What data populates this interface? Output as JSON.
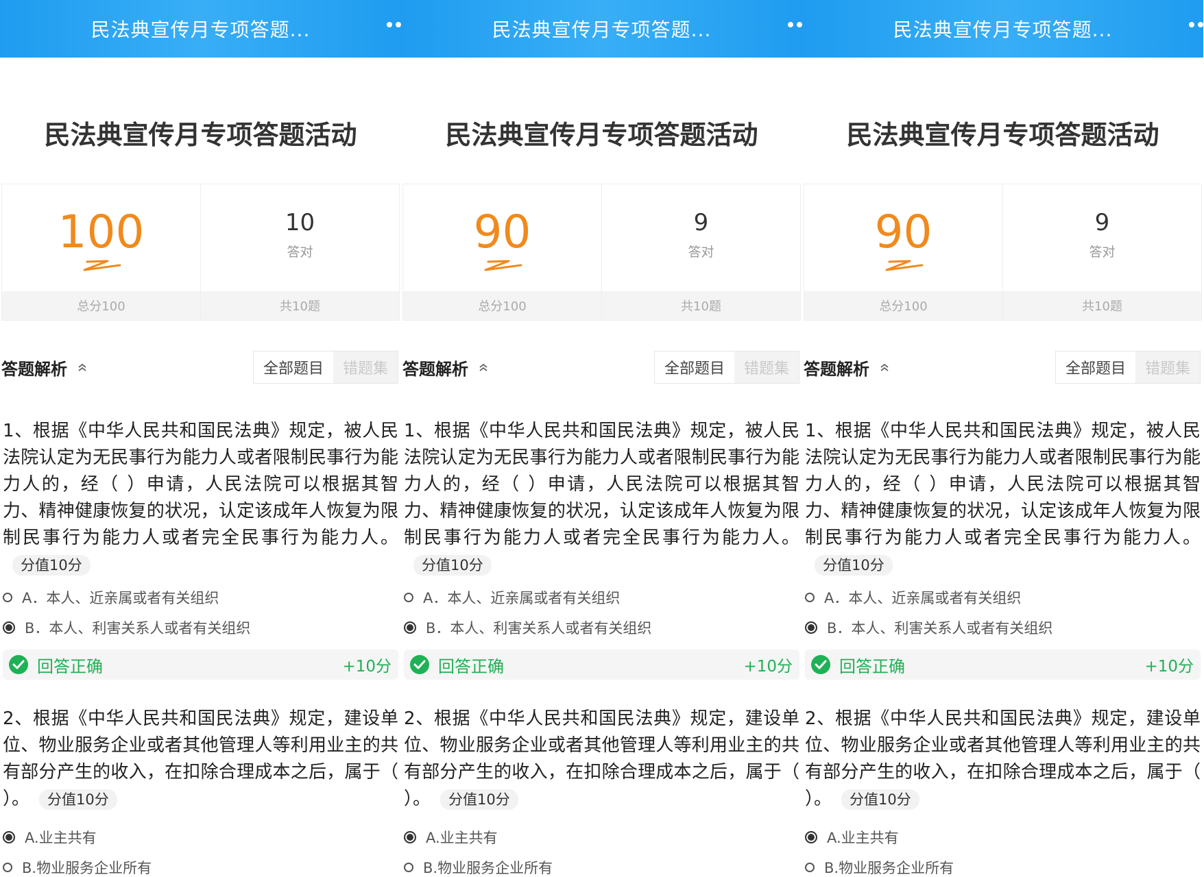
{
  "screens": [
    {
      "topbar_title": "民法典宣传月专项答题...",
      "activity_title": "民法典宣传月专项答题活动",
      "score": "100",
      "total_score_label": "总分100",
      "correct_count": "10",
      "correct_label": "答对",
      "total_questions_label": "共10题",
      "analysis_title": "答题解析",
      "tab_all": "全部题目",
      "tab_wrong": "错题集",
      "q1_text": "1、根据《中华人民共和国民法典》规定，被人民法院认定为无民事行为能力人或者限制民事行为能力人的，经（ ）申请，人民法院可以根据其智力、精神健康恢复的状况，认定该成年人恢复为限制民事行为能力人或者完全民事行为能力人。",
      "q1_points": "分值10分",
      "q1_option_a": "A．本人、近亲属或者有关组织",
      "q1_option_b": "B．本人、利害关系人或者有关组织",
      "q1_result": "回答正确",
      "q1_gain": "+10分",
      "q2_text": "2、根据《中华人民共和国民法典》规定，建设单位、物业服务企业或者其他管理人等利用业主的共有部分产生的收入，在扣除合理成本之后，属于（ ）。",
      "q2_points": "分值10分",
      "q2_option_a": "A.业主共有",
      "q2_option_b": "B.物业服务企业所有"
    },
    {
      "topbar_title": "民法典宣传月专项答题...",
      "activity_title": "民法典宣传月专项答题活动",
      "score": "90",
      "total_score_label": "总分100",
      "correct_count": "9",
      "correct_label": "答对",
      "total_questions_label": "共10题",
      "analysis_title": "答题解析",
      "tab_all": "全部题目",
      "tab_wrong": "错题集",
      "q1_text": "1、根据《中华人民共和国民法典》规定，被人民法院认定为无民事行为能力人或者限制民事行为能力人的，经（ ）申请，人民法院可以根据其智力、精神健康恢复的状况，认定该成年人恢复为限制民事行为能力人或者完全民事行为能力人。",
      "q1_points": "分值10分",
      "q1_option_a": "A．本人、近亲属或者有关组织",
      "q1_option_b": "B．本人、利害关系人或者有关组织",
      "q1_result": "回答正确",
      "q1_gain": "+10分",
      "q2_text": "2、根据《中华人民共和国民法典》规定，建设单位、物业服务企业或者其他管理人等利用业主的共有部分产生的收入，在扣除合理成本之后，属于（ ）。",
      "q2_points": "分值10分",
      "q2_option_a": "A.业主共有",
      "q2_option_b": "B.物业服务企业所有"
    },
    {
      "topbar_title": "民法典宣传月专项答题...",
      "activity_title": "民法典宣传月专项答题活动",
      "score": "90",
      "total_score_label": "总分100",
      "correct_count": "9",
      "correct_label": "答对",
      "total_questions_label": "共10题",
      "analysis_title": "答题解析",
      "tab_all": "全部题目",
      "tab_wrong": "错题集",
      "q1_text": "1、根据《中华人民共和国民法典》规定，被人民法院认定为无民事行为能力人或者限制民事行为能力人的，经（ ）申请，人民法院可以根据其智力、精神健康恢复的状况，认定该成年人恢复为限制民事行为能力人或者完全民事行为能力人。",
      "q1_points": "分值10分",
      "q1_option_a": "A．本人、近亲属或者有关组织",
      "q1_option_b": "B．本人、利害关系人或者有关组织",
      "q1_result": "回答正确",
      "q1_gain": "+10分",
      "q2_text": "2、根据《中华人民共和国民法典》规定，建设单位、物业服务企业或者其他管理人等利用业主的共有部分产生的收入，在扣除合理成本之后，属于（ ）。",
      "q2_points": "分值10分",
      "q2_option_a": "A.业主共有",
      "q2_option_b": "B.物业服务企业所有"
    }
  ],
  "colors": {
    "topbar": "#1f9cf0",
    "score": "#f08a1c",
    "correct": "#1fb155"
  }
}
